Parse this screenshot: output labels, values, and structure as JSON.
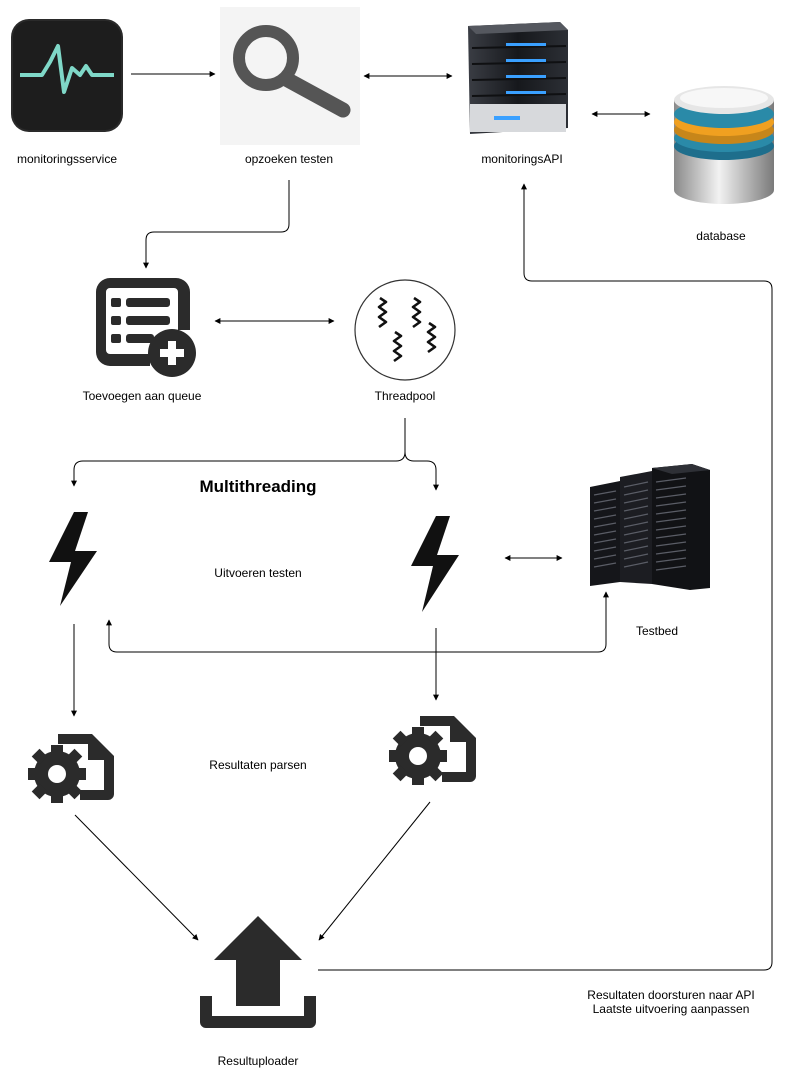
{
  "labels": {
    "monitoringsservice": "monitoringsservice",
    "opzoeken_testen": "opzoeken testen",
    "monitorings_api": "monitoringsAPI",
    "database": "database",
    "toevoegen_queue": "Toevoegen aan queue",
    "threadpool": "Threadpool",
    "multithreading": "Multithreading",
    "uitvoeren_testen": "Uitvoeren testen",
    "testbed": "Testbed",
    "resultaten_parsen": "Resultaten parsen",
    "resultuploader": "Resultuploader",
    "doorsturen_line1": "Resultaten doorsturen naar API",
    "doorsturen_line2": "Laatste uitvoering aanpassen"
  },
  "icons": {
    "monitor": "pulse-monitor-icon",
    "search": "magnifier-icon",
    "server": "server-icon",
    "database": "database-icon",
    "queue": "list-add-icon",
    "threadpool": "thread-pool-icon",
    "thread": "lightning-bolt-icon",
    "testbed": "server-rack-icon",
    "parser": "file-gear-icon",
    "uploader": "upload-icon"
  },
  "colors": {
    "pulse": "#7fd8c8",
    "server_light": "#3aa0ff",
    "db_orange": "#f0a020",
    "db_teal": "#2a8aa8",
    "icon_dark": "#2b2b2b"
  }
}
